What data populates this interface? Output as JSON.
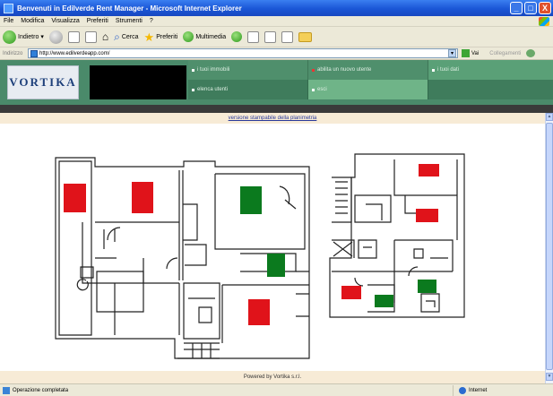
{
  "window": {
    "title": "Benvenuti in Edilverde Rent Manager - Microsoft Internet Explorer",
    "buttons": {
      "minimize": "_",
      "maximize": "□",
      "close": "X"
    }
  },
  "menu": [
    "File",
    "Modifica",
    "Visualizza",
    "Preferiti",
    "Strumenti",
    "?"
  ],
  "toolbar": {
    "back": "Indietro",
    "search": "Cerca",
    "favorites": "Preferiti",
    "media": "Multimedia"
  },
  "address": {
    "label": "Indirizzo",
    "url": "http://www.edilverdeapp.com/",
    "go": "Vai",
    "links": "Collegamenti"
  },
  "app": {
    "logo": "VORTIKA",
    "nav": [
      {
        "label": "i tuoi immobili",
        "bullet": "white"
      },
      {
        "label": "abilita un nuovo utente",
        "bullet": "red"
      },
      {
        "label": "i tuoi dati",
        "bullet": "white"
      },
      {
        "label": "elenca utenti",
        "bullet": "white"
      },
      {
        "label": "esci",
        "bullet": "white"
      },
      {
        "label": "",
        "bullet": ""
      }
    ]
  },
  "content": {
    "print_link": "versione stampabile della planimetria",
    "footer": "Powered by Vortika s.r.l."
  },
  "status": {
    "text": "Operazione completata",
    "zone": "Internet"
  },
  "colors": {
    "occupied": "#e0131a",
    "available": "#0b7a1e",
    "nav_green": "#4a8a6a"
  }
}
